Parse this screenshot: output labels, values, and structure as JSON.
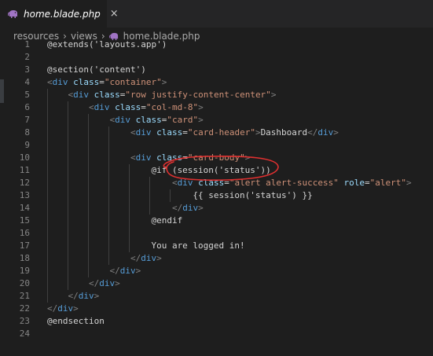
{
  "tab": {
    "title": "home.blade.php",
    "close_glyph": "×",
    "icon": "php-elephant-icon",
    "icon_color": "#a074c4"
  },
  "breadcrumb": {
    "items": [
      "resources",
      "views",
      "home.blade.php"
    ],
    "separator": "›"
  },
  "editor": {
    "line_numbers": [
      "1",
      "2",
      "3",
      "4",
      "5",
      "6",
      "7",
      "8",
      "9",
      "10",
      "11",
      "12",
      "13",
      "14",
      "15",
      "16",
      "17",
      "18",
      "19",
      "20",
      "21",
      "22",
      "23",
      "24"
    ],
    "lines": [
      "@extends('layouts.app')",
      "",
      "@section('content')",
      "<div class=\"container\">",
      "    <div class=\"row justify-content-center\">",
      "        <div class=\"col-md-8\">",
      "            <div class=\"card\">",
      "                <div class=\"card-header\">Dashboard</div>",
      "",
      "                <div class=\"card-body\">",
      "                    @if (session('status'))",
      "                        <div class=\"alert alert-success\" role=\"alert\">",
      "                            {{ session('status') }}",
      "                        </div>",
      "                    @endif",
      "",
      "                    You are logged in!",
      "                </div>",
      "            </div>",
      "        </div>",
      "    </div>",
      "</div>",
      "@endsection",
      ""
    ]
  },
  "colors": {
    "editor_bg": "#1e1e1e",
    "tag": "#569cd6",
    "attr": "#9cdcfe",
    "string": "#ce9178",
    "annotation": "#e03030"
  }
}
